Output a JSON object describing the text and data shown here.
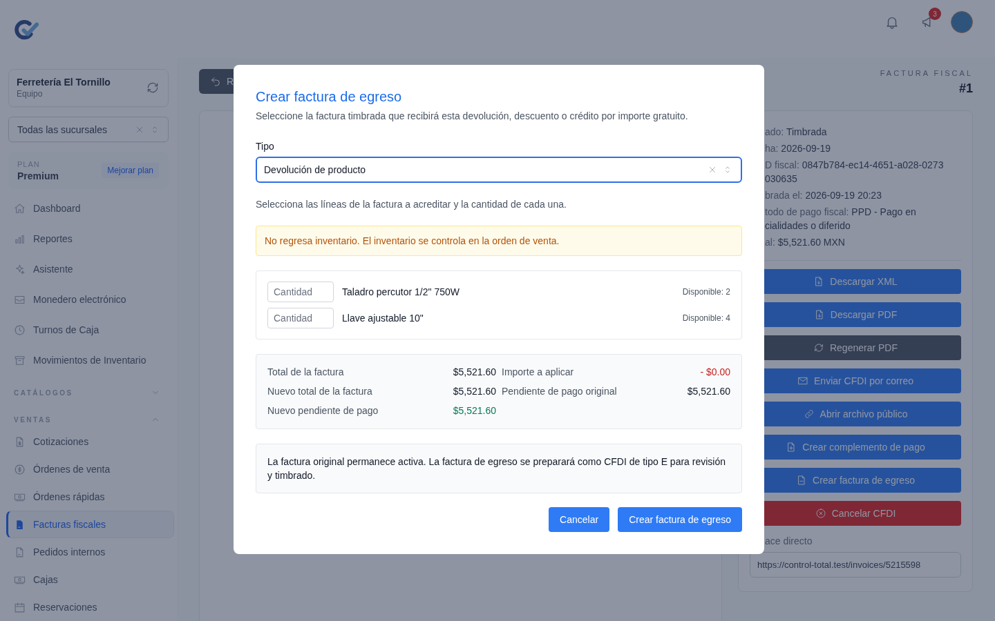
{
  "header": {
    "announcements_badge": "3"
  },
  "sidebar": {
    "company": {
      "name": "Ferretería El Tornillo",
      "subtitle": "Equipo"
    },
    "branch_select": {
      "value": "Todas las sucursales"
    },
    "plan": {
      "label": "PLAN",
      "name": "Premium",
      "link": "Mejorar plan"
    },
    "items": [
      {
        "label": "Dashboard",
        "selected": false
      },
      {
        "label": "Reportes",
        "selected": false
      },
      {
        "label": "Asistente",
        "selected": false
      },
      {
        "label": "Monedero electrónico",
        "selected": false
      },
      {
        "label": "Turnos de Caja",
        "selected": false
      },
      {
        "label": "Movimientos de Inventario",
        "selected": false
      }
    ],
    "sections": [
      {
        "title": "CATÁLOGOS",
        "expanded": false
      },
      {
        "title": "VENTAS",
        "expanded": true,
        "items": [
          {
            "label": "Cotizaciones",
            "selected": false
          },
          {
            "label": "Órdenes de venta",
            "selected": false
          },
          {
            "label": "Órdenes rápidas",
            "selected": false
          },
          {
            "label": "Facturas fiscales",
            "selected": true
          },
          {
            "label": "Pedidos internos",
            "selected": false
          },
          {
            "label": "Cajas",
            "selected": false
          },
          {
            "label": "Reservaciones",
            "selected": false
          }
        ]
      }
    ]
  },
  "page": {
    "back_button": "R",
    "eyebrow": "FACTURA FISCAL",
    "number": "#1"
  },
  "invoice_panel": {
    "details": [
      {
        "label": "ado:",
        "lines": [
          "Timbrada"
        ]
      },
      {
        "label": "ha:",
        "lines": [
          "2026-09-19"
        ]
      },
      {
        "label": "D fiscal:",
        "lines": [
          "0847b784-ec14-4651-a028-0273",
          "030635"
        ]
      },
      {
        "label": "brada el:",
        "lines": [
          "2026-09-19 20:23"
        ]
      },
      {
        "label": "todo de pago fiscal:",
        "lines": [
          "PPD - Pago en",
          "cialidades o diferido"
        ]
      },
      {
        "label": "al:",
        "lines": [
          "$5,521.60 MXN"
        ]
      }
    ],
    "actions": [
      {
        "label": "Descargar XML",
        "kind": "primary"
      },
      {
        "label": "Descargar PDF",
        "kind": "primary"
      },
      {
        "label": "Regenerar PDF",
        "kind": "secondary"
      },
      {
        "label": "Enviar CFDI por correo",
        "kind": "primary"
      },
      {
        "label": "Abrir archivo público",
        "kind": "primary"
      },
      {
        "label": "Crear complemento de pago",
        "kind": "primary"
      },
      {
        "label": "Crear factura de egreso",
        "kind": "primary"
      },
      {
        "label": "Cancelar CFDI",
        "kind": "danger"
      }
    ],
    "link_label": "ace directo",
    "link_value": "https://control-total.test/invoices/5215598"
  },
  "modal": {
    "title": "Crear factura de egreso",
    "description": "Seleccione la factura timbrada que recibirá esta devolución, descuento o crédito por importe gratuito.",
    "type_field": {
      "label": "Tipo",
      "value": "Devolución de producto"
    },
    "instruction": "Selecciona las líneas de la factura a acreditar y la cantidad de cada una.",
    "warning": "No regresa inventario. El inventario se controla en la orden de venta.",
    "lines": [
      {
        "placeholder": "Cantidad",
        "name": "Taladro percutor 1/2\" 750W",
        "available": "Disponible: 2"
      },
      {
        "placeholder": "Cantidad",
        "name": "Llave ajustable 10\"",
        "available": "Disponible: 4"
      }
    ],
    "summary_left": [
      {
        "label": "Total de la factura",
        "value": "$5,521.60",
        "kind": "neutral"
      },
      {
        "label": "Nuevo total de la factura",
        "value": "$5,521.60",
        "kind": "neutral"
      },
      {
        "label": "Nuevo pendiente de pago",
        "value": "$5,521.60",
        "kind": "positive"
      }
    ],
    "summary_right": [
      {
        "label": "Importe a aplicar",
        "value": "- $0.00",
        "kind": "negative"
      },
      {
        "label": "Pendiente de pago original",
        "value": "$5,521.60",
        "kind": "neutral"
      }
    ],
    "note": "La factura original permanece activa. La factura de egreso se preparará como CFDI de tipo E para revisión y timbrado.",
    "buttons": [
      {
        "label": "Cancelar",
        "kind": "primary"
      },
      {
        "label": "Crear factura de egreso",
        "kind": "primary"
      }
    ]
  }
}
